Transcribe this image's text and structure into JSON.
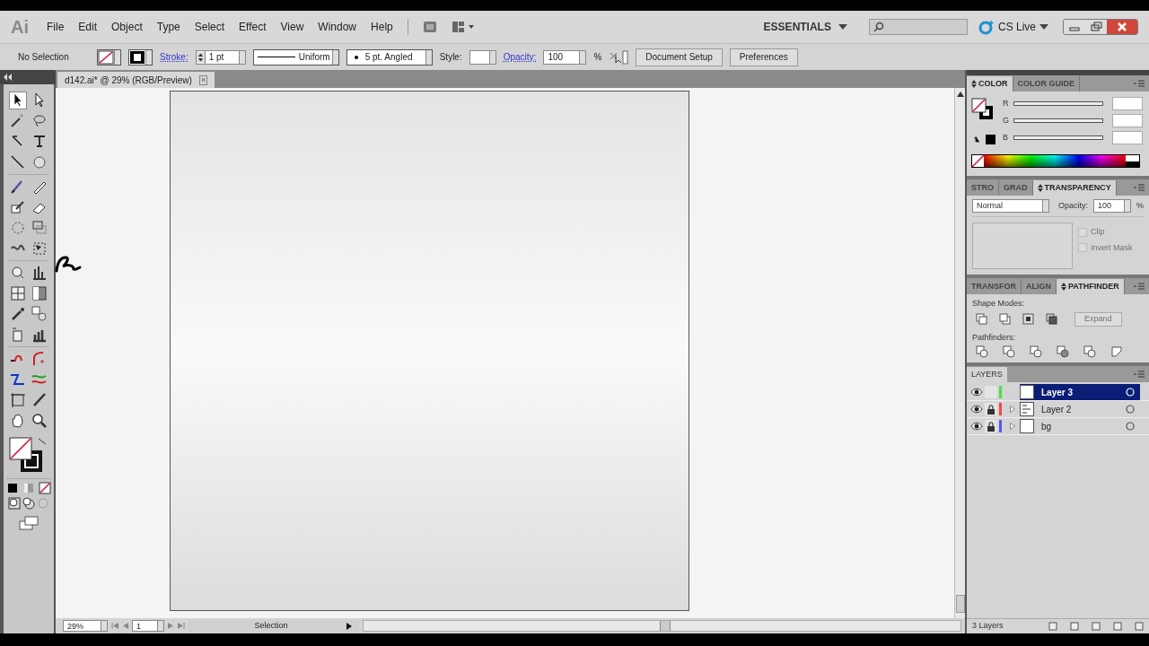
{
  "app": {
    "logo": "Ai"
  },
  "menu": [
    "File",
    "Edit",
    "Object",
    "Type",
    "Select",
    "Effect",
    "View",
    "Window",
    "Help"
  ],
  "workspace": {
    "label": "ESSENTIALS"
  },
  "cs_live": {
    "label": "CS Live"
  },
  "control_bar": {
    "selection": "No Selection",
    "stroke_label": "Stroke:",
    "stroke_value": "1 pt",
    "profile": "Uniform",
    "brush": "5 pt. Angled",
    "style_label": "Style:",
    "opacity_label": "Opacity:",
    "opacity_value": "100",
    "percent": "%",
    "buttons": [
      "Document Setup",
      "Preferences"
    ]
  },
  "document_tab": {
    "title": "d142.ai* @ 29% (RGB/Preview)",
    "close": "×"
  },
  "color_panel": {
    "tabs": [
      {
        "label": "COLOR",
        "selected": true
      },
      {
        "label": "COLOR GUIDE",
        "selected": false
      }
    ],
    "channels": [
      {
        "label": "R",
        "level": 0
      },
      {
        "label": "G",
        "level": 0
      },
      {
        "label": "B",
        "level": 0
      }
    ]
  },
  "transparency_panel": {
    "tabs": [
      {
        "label": "STRO",
        "selected": false
      },
      {
        "label": "GRAD",
        "selected": false
      },
      {
        "label": "TRANSPARENCY",
        "selected": true
      }
    ],
    "blend_mode": "Normal",
    "opacity_label": "Opacity:",
    "opacity_value": "100",
    "percent": "%",
    "options": [
      {
        "label": "Clip",
        "checked": false,
        "disabled": true
      },
      {
        "label": "Invert Mask",
        "checked": false,
        "disabled": true
      }
    ]
  },
  "pathfinder_panel": {
    "tabs": [
      {
        "label": "TRANSFOR",
        "selected": false
      },
      {
        "label": "ALIGN",
        "selected": false
      },
      {
        "label": "PATHFINDER",
        "selected": true
      }
    ],
    "shape_modes_label": "Shape Modes:",
    "expand": {
      "label": "Expand",
      "disabled": true
    },
    "pathfinders_label": "Pathfinders:"
  },
  "layers_panel": {
    "tab": "LAYERS",
    "layers": [
      {
        "name": "Layer 3",
        "selected": true,
        "locked": false,
        "expandable": false,
        "color": "#4ae04a"
      },
      {
        "name": "Layer 2",
        "selected": false,
        "locked": true,
        "expandable": true,
        "color": "#f04848"
      },
      {
        "name": "bg",
        "selected": false,
        "locked": true,
        "expandable": true,
        "color": "#5858f0"
      }
    ],
    "count": "3 Layers"
  },
  "status_bar": {
    "zoom": "29%",
    "page": "1",
    "tool": "Selection"
  }
}
